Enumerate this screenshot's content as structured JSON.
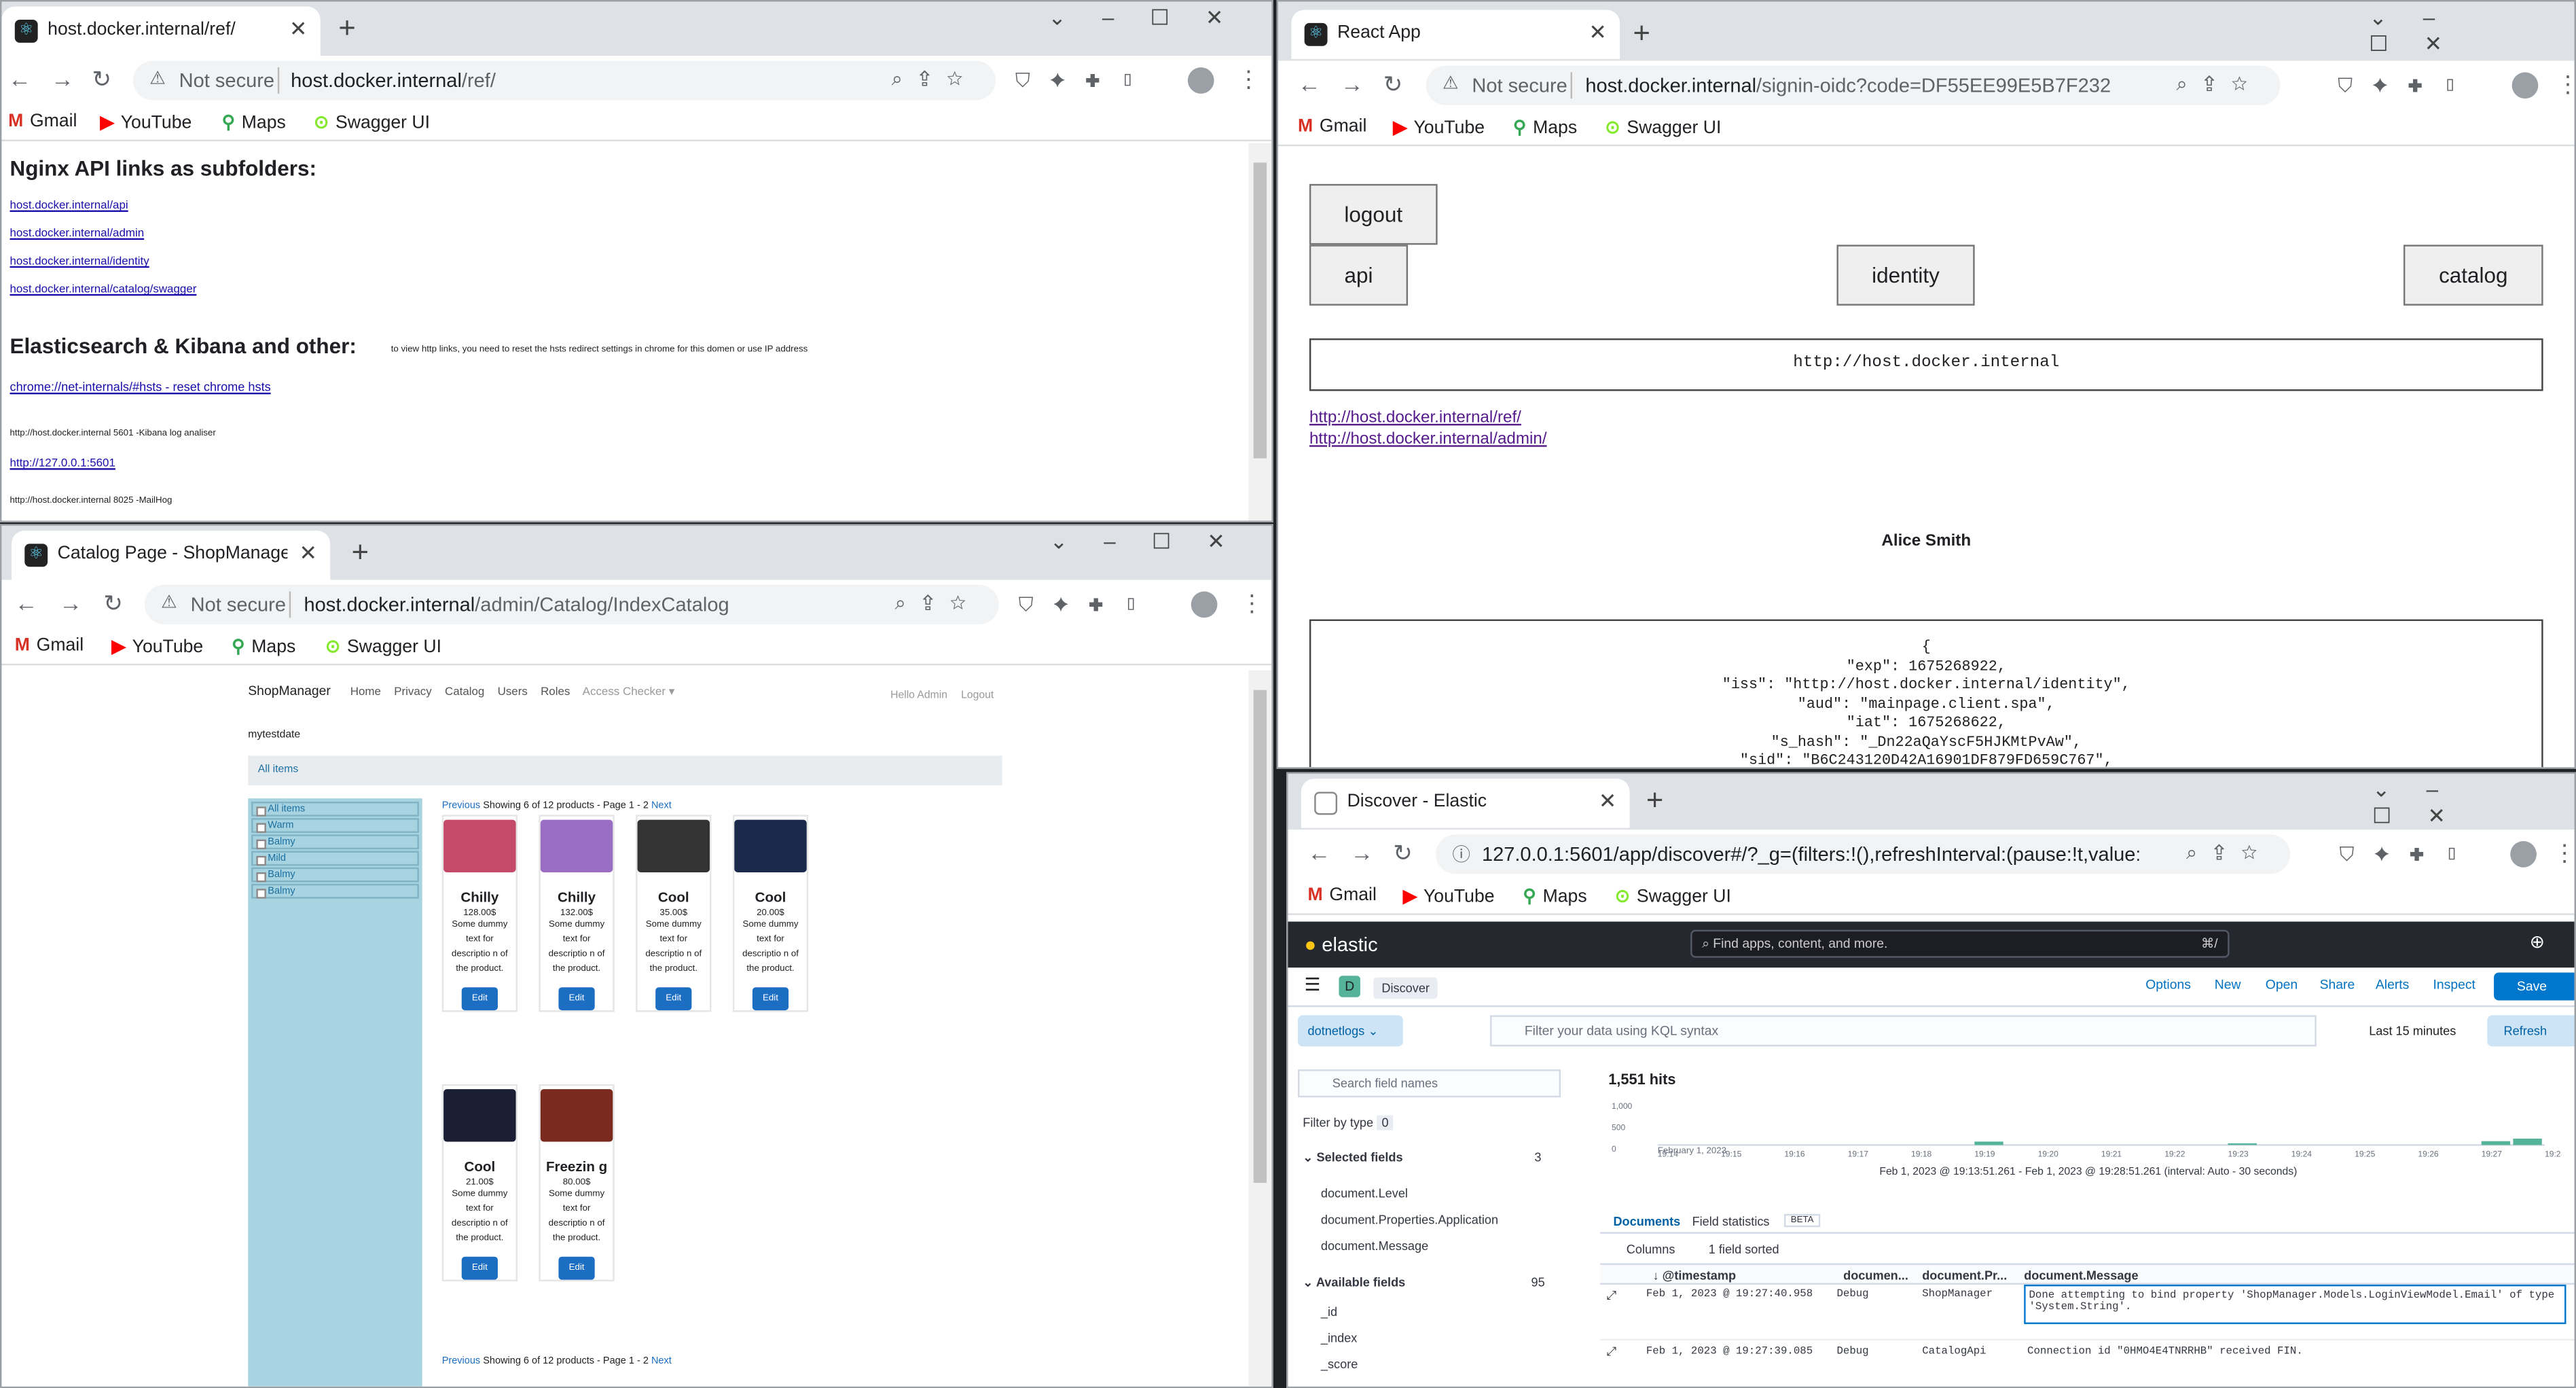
{
  "browser": {
    "bookmarks": [
      "Gmail",
      "YouTube",
      "Maps",
      "Swagger UI"
    ],
    "not_secure": "Not secure",
    "new_tab": "+",
    "close": "✕"
  },
  "win1": {
    "tab_title": "host.docker.internal/ref/",
    "url_host": "host.docker.internal",
    "url_path": "/ref/",
    "h1": "Nginx API links as subfolders:",
    "links": [
      "host.docker.internal/api",
      "host.docker.internal/admin",
      "host.docker.internal/identity",
      "host.docker.internal/catalog/swagger"
    ],
    "h2": "Elasticsearch & Kibana and other:",
    "h2_note": "to view http links, you need to reset the hsts redirect settings in chrome for this domen or use IP address",
    "hsts_link": "chrome://net-internals/#hsts - reset chrome hsts",
    "kibana_text": "http://host.docker.internal 5601 -Kibana log analiser",
    "kibana_link": "http://127.0.0.1:5601",
    "mailhog_text": "http://host.docker.internal 8025 -MailHog"
  },
  "win2": {
    "tab_title": "Catalog Page - ShopManager",
    "url_host": "host.docker.internal",
    "url_path": "/admin/Catalog/IndexCatalog",
    "brand": "ShopManager",
    "nav": [
      "Home",
      "Privacy",
      "Catalog",
      "Users",
      "Roles",
      "Access Checker ▾"
    ],
    "hello": "Hello Admin",
    "logout": "Logout",
    "subtitle": "mytestdate",
    "all_items_bar": "All items",
    "categories": [
      "All items",
      "Warm",
      "Balmy",
      "Mild",
      "Balmy",
      "Balmy"
    ],
    "pager_prev": "Previous",
    "pager_text": "Showing 6 of 12 products - Page 1 - 2",
    "pager_next": "Next",
    "edit": "Edit",
    "products": [
      {
        "name": "Chilly",
        "price": "128.00$",
        "desc": "Some dummy text for descriptio n of the product.",
        "color": "#c44a6a"
      },
      {
        "name": "Chilly",
        "price": "132.00$",
        "desc": "Some dummy text for descriptio n of the product.",
        "color": "#9a6ec4"
      },
      {
        "name": "Cool",
        "price": "35.00$",
        "desc": "Some dummy text for descriptio n of the product.",
        "color": "#333"
      },
      {
        "name": "Cool",
        "price": "20.00$",
        "desc": "Some dummy text for descriptio n of the product.",
        "color": "#1b2a4a"
      },
      {
        "name": "Cool",
        "price": "21.00$",
        "desc": "Some dummy text for descriptio n of the product.",
        "color": "#1a1f35"
      },
      {
        "name": "Freezin g",
        "price": "80.00$",
        "desc": "Some dummy text for descriptio n of the product.",
        "color": "#7a2a1e"
      }
    ]
  },
  "win3": {
    "tab_title": "React App",
    "url_host": "host.docker.internal",
    "url_path": "/signin-oidc?code=DF55EE99E5B7F232B802A1E6...",
    "logout": "logout",
    "api": "api",
    "identity": "identity",
    "catalog": "catalog",
    "base_url": "http://host.docker.internal",
    "links": [
      "http://host.docker.internal/ref/",
      "http://host.docker.internal/admin/"
    ],
    "user": "Alice Smith",
    "token_lines": [
      "{",
      "\"exp\": 1675268922,",
      "\"iss\": \"http://host.docker.internal/identity\",",
      "\"aud\": \"mainpage.client.spa\",",
      "\"iat\": 1675268622,",
      "\"s_hash\": \"_Dn22aQaYscF5HJKMtPvAw\",",
      "\"sid\": \"B6C243120D42A16901DF879FD659C767\","
    ]
  },
  "win4": {
    "tab_title": "Discover - Elastic",
    "url": "127.0.0.1:5601/app/discover#/?_g=(filters:!(),refreshInterval:(pause:!t,value:0),time:(...",
    "logo": "elastic",
    "search": "Find apps, content, and more.",
    "search_kbd": "⌘/",
    "app_badge": "D",
    "app_name": "Discover",
    "menu": [
      "Options",
      "New",
      "Open",
      "Share",
      "Alerts",
      "Inspect"
    ],
    "save": "Save",
    "index": "dotnetlogs",
    "kql": "Filter your data using KQL syntax",
    "time": "Last 15 minutes",
    "refresh": "Refresh",
    "field_search": "Search field names",
    "filter_type": "Filter by type",
    "filter_count": "0",
    "selected": "Selected fields",
    "selected_count": "3",
    "selected_fields": [
      "document.Level",
      "document.Properties.Application",
      "document.Message"
    ],
    "available": "Available fields",
    "available_count": "95",
    "available_fields": [
      "_id",
      "_index",
      "_score"
    ],
    "hits": "1,551 hits",
    "y_ticks": [
      "1,000",
      "500",
      "0"
    ],
    "x_ticks": [
      "19:14",
      "19:15",
      "19:16",
      "19:17",
      "19:18",
      "19:19",
      "19:20",
      "19:21",
      "19:22",
      "19:23",
      "19:24",
      "19:25",
      "19:26",
      "19:27",
      "19:28"
    ],
    "x_date": "February 1, 2023",
    "range": "Feb 1, 2023 @ 19:13:51.261 - Feb 1, 2023 @ 19:28:51.261 (interval: Auto - 30 seconds)",
    "tab_docs": "Documents",
    "tab_stats": "Field statistics",
    "beta": "BETA",
    "columns": "Columns",
    "sorted": "1 field sorted",
    "headers": [
      "@timestamp",
      "documen...",
      "document.Pr...",
      "document.Message"
    ],
    "rows": [
      {
        "ts": "Feb 1, 2023 @ 19:27:40.958",
        "level": "Debug",
        "app": "ShopManager",
        "msg": "Done attempting to bind property 'ShopManager.Models.LoginViewModel.Email' of type 'System.String'."
      },
      {
        "ts": "Feb 1, 2023 @ 19:27:39.085",
        "level": "Debug",
        "app": "CatalogApi",
        "msg": "Connection id \"0HMO4E4TNRRHB\" received FIN."
      }
    ],
    "chart_data": {
      "type": "bar",
      "title": "",
      "xlabel": "",
      "ylabel": "",
      "ylim": [
        0,
        1000
      ],
      "categories": [
        "19:19",
        "19:23",
        "19:27",
        "19:27:30"
      ],
      "values": [
        80,
        40,
        90,
        150
      ]
    }
  }
}
